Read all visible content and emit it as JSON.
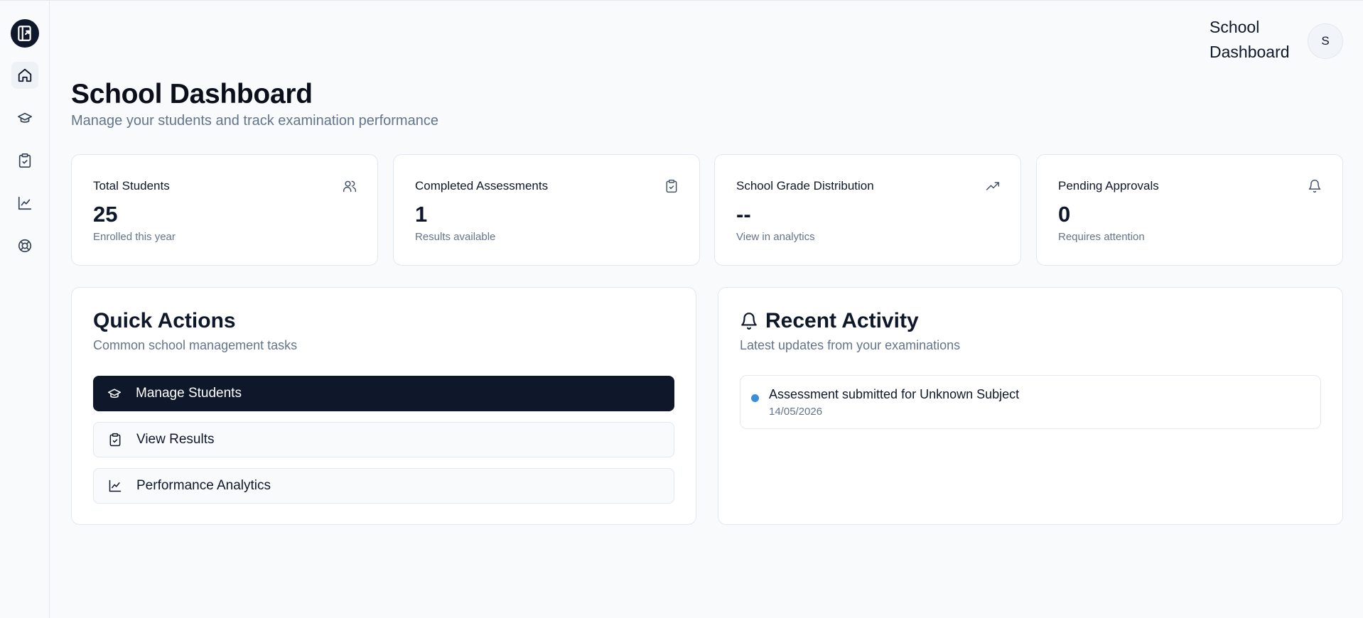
{
  "header": {
    "user_title": "School Dashboard",
    "avatar_initial": "S"
  },
  "sidebar": {
    "items": [
      {
        "icon": "home-icon",
        "active": true
      },
      {
        "icon": "graduation-cap-icon",
        "active": false
      },
      {
        "icon": "clipboard-check-icon",
        "active": false
      },
      {
        "icon": "line-chart-icon",
        "active": false
      },
      {
        "icon": "lifebuoy-icon",
        "active": false
      }
    ]
  },
  "page": {
    "title": "School Dashboard",
    "subtitle": "Manage your students and track examination performance"
  },
  "stats": [
    {
      "label": "Total Students",
      "value": "25",
      "note": "Enrolled this year",
      "icon": "users-icon"
    },
    {
      "label": "Completed Assessments",
      "value": "1",
      "note": "Results available",
      "icon": "clipboard-check-icon"
    },
    {
      "label": "School Grade Distribution",
      "value": "--",
      "note": "View in analytics",
      "icon": "trending-up-icon"
    },
    {
      "label": "Pending Approvals",
      "value": "0",
      "note": "Requires attention",
      "icon": "bell-icon"
    }
  ],
  "quick_actions": {
    "title": "Quick Actions",
    "subtitle": "Common school management tasks",
    "buttons": [
      {
        "label": "Manage Students",
        "icon": "graduation-cap-icon"
      },
      {
        "label": "View Results",
        "icon": "clipboard-check-icon"
      },
      {
        "label": "Performance Analytics",
        "icon": "line-chart-icon"
      }
    ]
  },
  "recent_activity": {
    "title": "Recent Activity",
    "subtitle": "Latest updates from your examinations",
    "items": [
      {
        "text": "Assessment submitted for Unknown Subject",
        "date": "14/05/2026",
        "dot_color": "#3b8fd9"
      }
    ]
  },
  "colors": {
    "primary": "#0f172a",
    "muted": "#64748b",
    "border": "#e2e8f0",
    "accent_dot": "#3b8fd9"
  }
}
